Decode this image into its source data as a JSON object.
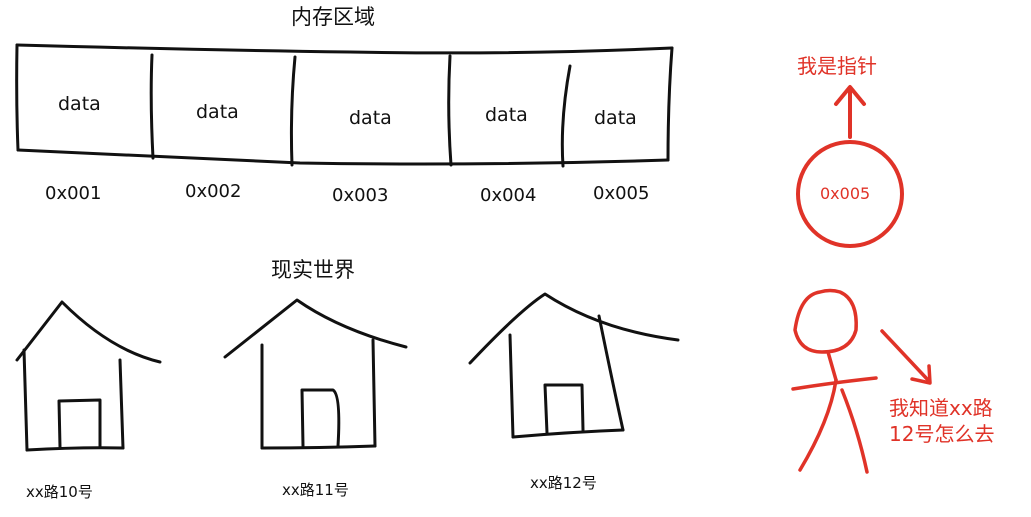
{
  "memory": {
    "title": "内存区域",
    "cells": [
      {
        "label": "data",
        "address": "0x001"
      },
      {
        "label": "data",
        "address": "0x002"
      },
      {
        "label": "data",
        "address": "0x003"
      },
      {
        "label": "data",
        "address": "0x004"
      },
      {
        "label": "data",
        "address": "0x005"
      }
    ]
  },
  "pointer": {
    "label": "我是指针",
    "value": "0x005"
  },
  "real_world": {
    "title": "现实世界",
    "houses": [
      {
        "label": "xx路10号"
      },
      {
        "label": "xx路11号"
      },
      {
        "label": "xx路12号"
      }
    ]
  },
  "person": {
    "speech_line1": "我知道xx路",
    "speech_line2": "12号怎么去"
  },
  "colors": {
    "ink": "#111111",
    "accent_red": "#e03328"
  }
}
